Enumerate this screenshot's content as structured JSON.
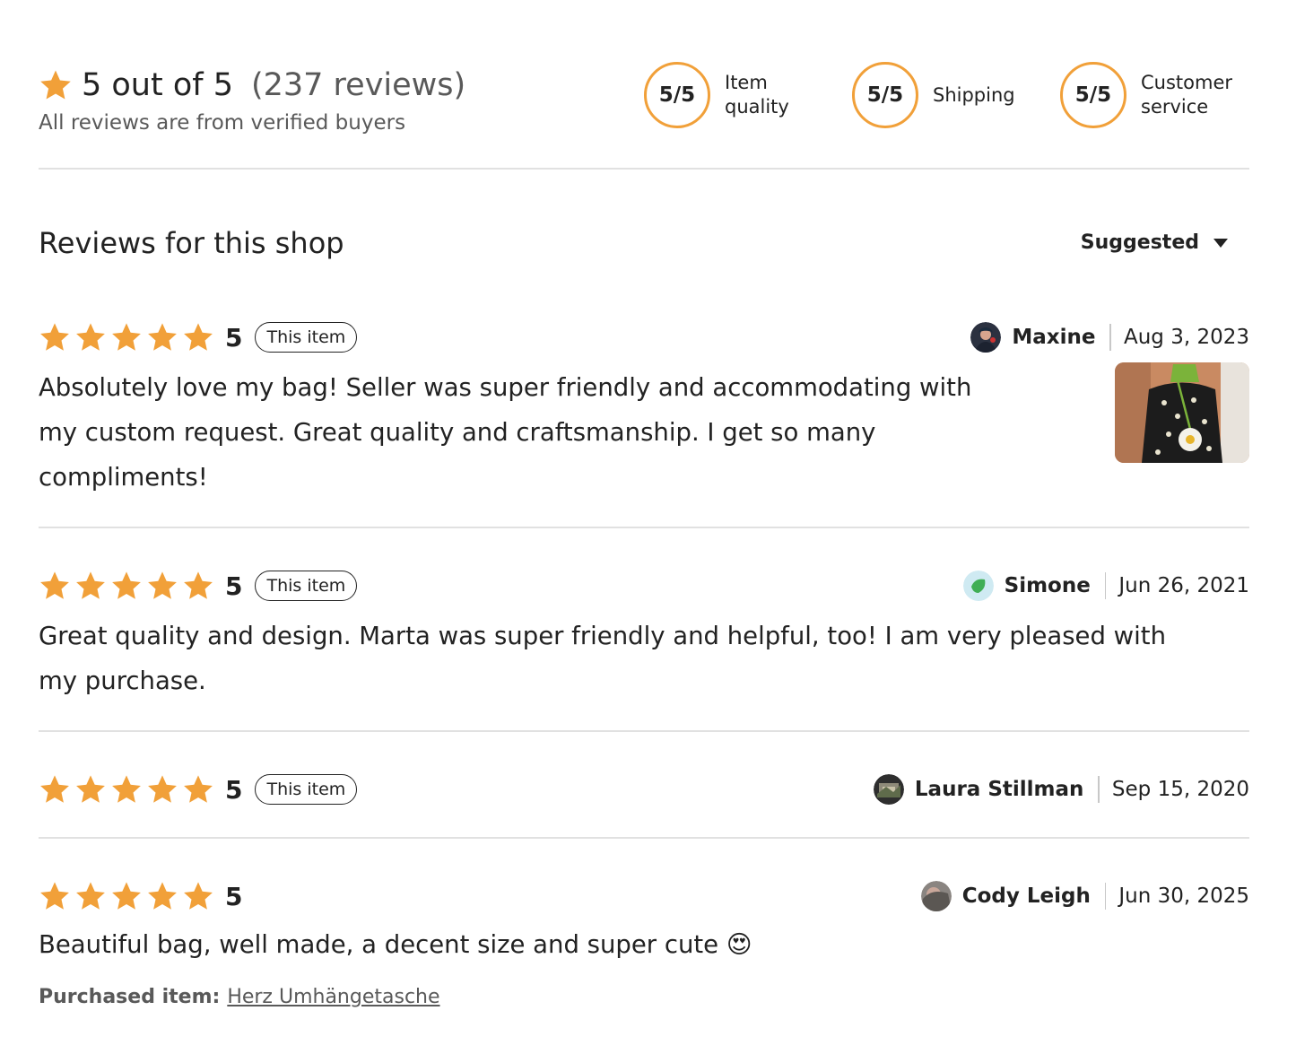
{
  "summary": {
    "score_text": "5 out of 5",
    "count_text": "(237 reviews)",
    "subtitle": "All reviews are from verified buyers",
    "accent_color": "#f1a039",
    "metrics": [
      {
        "score": "5/5",
        "label_line1": "Item",
        "label_line2": "quality"
      },
      {
        "score": "5/5",
        "label_line1": "Shipping",
        "label_line2": ""
      },
      {
        "score": "5/5",
        "label_line1": "Customer",
        "label_line2": "service"
      }
    ]
  },
  "section": {
    "title": "Reviews for this shop",
    "sort_label": "Suggested",
    "sort_icon": "caret-down-icon"
  },
  "reviews": [
    {
      "rating": "5",
      "stars": 5,
      "tag": "This item",
      "reviewer": "Maxine",
      "date": "Aug 3, 2023",
      "text_lines": [
        "Absolutely love my bag! Seller was super friendly and accommodating with",
        "my custom request. Great quality and craftsmanship. I get so many",
        "compliments!"
      ],
      "has_photo": true
    },
    {
      "rating": "5",
      "stars": 5,
      "tag": "This item",
      "reviewer": "Simone",
      "date": "Jun 26, 2021",
      "text_lines": [
        "Great quality and design. Marta was super friendly and helpful, too! I am very pleased with",
        "my purchase."
      ],
      "has_photo": false
    },
    {
      "rating": "5",
      "stars": 5,
      "tag": "This item",
      "reviewer": "Laura Stillman",
      "date": "Sep 15, 2020",
      "text_lines": [],
      "has_photo": false
    },
    {
      "rating": "5",
      "stars": 5,
      "tag": "",
      "reviewer": "Cody Leigh",
      "date": "Jun 30, 2025",
      "text_lines": [
        "Beautiful bag, well made, a decent size and super cute 😍"
      ],
      "purchased_label": "Purchased item:",
      "purchased_item": "Herz Umhängetasche",
      "has_photo": false
    }
  ]
}
